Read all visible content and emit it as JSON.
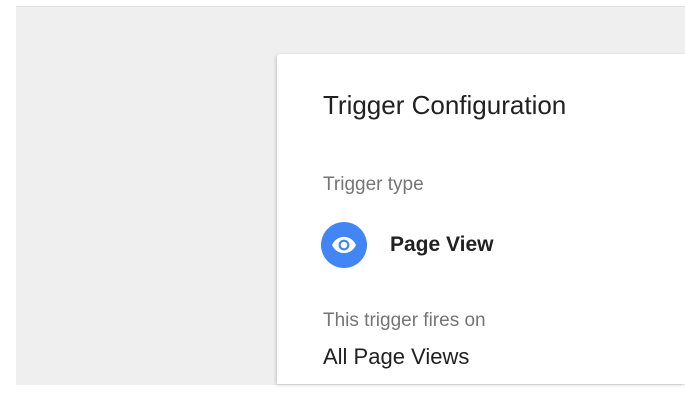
{
  "trigger_config": {
    "title": "Trigger Configuration",
    "trigger_type_label": "Trigger type",
    "trigger_type": {
      "name": "Page View",
      "icon": "eye-icon",
      "icon_bg_color": "#4285f4"
    },
    "fires_on_label": "This trigger fires on",
    "fires_on_value": "All Page Views"
  }
}
